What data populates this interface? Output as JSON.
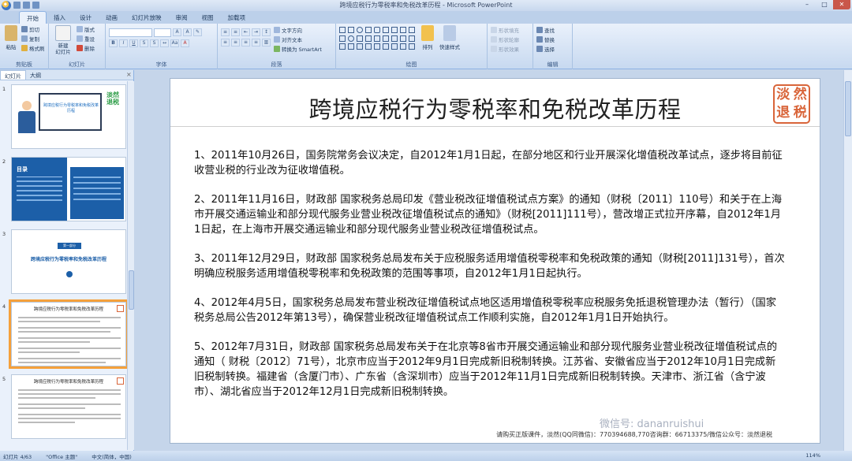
{
  "window": {
    "title": "跨境应税行为零税率和免税改革历程 - Microsoft PowerPoint",
    "minimize": "–",
    "maximize": "□",
    "close": "✕"
  },
  "ribbon_tabs": [
    "开始",
    "插入",
    "设计",
    "动画",
    "幻灯片放映",
    "审阅",
    "视图",
    "加载项"
  ],
  "ribbon": {
    "clipboard": {
      "paste": "粘贴",
      "cut": "剪切",
      "copy": "复制",
      "format_painter": "格式刷",
      "label": "剪贴板"
    },
    "slides": {
      "new_slide": "新建\n幻灯片",
      "layout": "版式",
      "reset": "重设",
      "delete": "删除",
      "label": "幻灯片"
    },
    "font": {
      "label": "字体"
    },
    "paragraph": {
      "text_direction": "文字方向",
      "align_text": "对齐文本",
      "smartart": "转换为 SmartArt",
      "label": "段落"
    },
    "drawing": {
      "arrange": "排列",
      "quick_styles": "快速样式",
      "shape_fill": "形状填充",
      "shape_outline": "形状轮廓",
      "shape_effects": "形状效果",
      "label": "绘图"
    },
    "editing": {
      "find": "查找",
      "replace": "替换",
      "select": "选择",
      "label": "编辑"
    }
  },
  "left_panel": {
    "tabs": [
      "幻灯片",
      "大纲"
    ],
    "close": "×",
    "thumbnails": [
      {
        "num": "1",
        "text": "跨境应税行为零税率和免税改革历程"
      },
      {
        "num": "2",
        "text": "目录"
      },
      {
        "num": "3",
        "text": "跨境应税行为零税率和免税改革历程",
        "badge": "第一部分"
      },
      {
        "num": "4",
        "text": "跨境应税行为零税率和免税改革历程",
        "selected": true
      },
      {
        "num": "5",
        "text": "跨境应税行为零税率和免税改革历程"
      }
    ]
  },
  "slide": {
    "title": "跨境应税行为零税率和免税改革历程",
    "seal": [
      "淡",
      "然",
      "退",
      "税"
    ],
    "paragraphs": [
      "1、2011年10月26日，国务院常务会议决定，自2012年1月1日起，在部分地区和行业开展深化增值税改革试点，逐步将目前征收营业税的行业改为征收增值税。",
      "2、2011年11月16日，财政部 国家税务总局印发《营业税改征增值税试点方案》的通知（财税〔2011〕110号）和关于在上海市开展交通运输业和部分现代服务业营业税改征增值税试点的通知》（财税[2011]111号），营改增正式拉开序幕，自2012年1月1日起，在上海市开展交通运输业和部分现代服务业营业税改征增值税试点。",
      "3、2011年12月29日，财政部 国家税务总局发布关于应税服务适用增值税零税率和免税政策的通知（财税[2011]131号），首次明确应税服务适用增值税零税率和免税政策的范围等事项，自2012年1月1日起执行。",
      "4、2012年4月5日，国家税务总局发布营业税改征增值税试点地区适用增值税零税率应税服务免抵退税管理办法（暂行）（国家税务总局公告2012年第13号），确保营业税改征增值税试点工作顺利实施，自2012年1月1日开始执行。",
      "5、2012年7月31日，财政部 国家税务总局发布关于在北京等8省市开展交通运输业和部分现代服务业营业税改征增值税试点的通知（ 财税〔2012〕71号），北京市应当于2012年9月1日完成新旧税制转换。江苏省、安徽省应当于2012年10月1日完成新旧税制转换。福建省（含厦门市）、广东省（含深圳市）应当于2012年11月1日完成新旧税制转换。天津市、浙江省（含宁波市）、湖北省应当于2012年12月1日完成新旧税制转换。"
    ],
    "footer": "请购买正版课件，淡然(QQ同微信)：770394688,770咨询群：66713375/微信公众号：淡然退税"
  },
  "watermark": {
    "text": "微信号: dananruishui"
  },
  "status": {
    "slide_of": "幻灯片 4/63",
    "theme": "\"Office 主题\"",
    "language": "中文(简体，中国)",
    "zoom": "114%"
  }
}
